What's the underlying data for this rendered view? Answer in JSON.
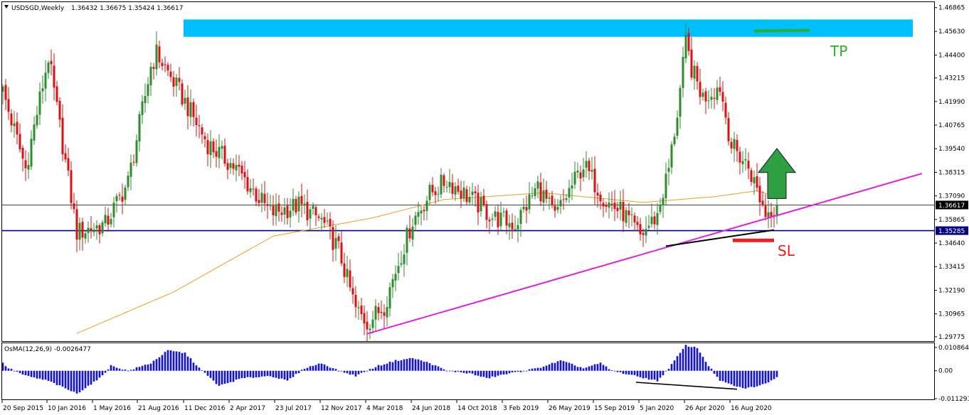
{
  "header": {
    "symbol_timeframe": "USDSGD,Weekly",
    "ohlc": "1.36432 1.36675 1.35424 1.36617"
  },
  "indicator": {
    "title": "OsMA(12,26,9) -0.0026477",
    "ticks": [
      "0.0108644",
      "0.00",
      "-0.0112917"
    ]
  },
  "annotations": {
    "tp": "TP",
    "sl": "SL"
  },
  "colors": {
    "bull": "#2e8b2e",
    "bear": "#dd1111",
    "ma": "#e8a020",
    "trendline": "#e020e0",
    "resistance_zone": "#00bfff",
    "osma": "#1010ee",
    "tp": "#2ab02a",
    "sl": "#ee1c1c",
    "arrow": "#2ea043",
    "support_line": "#000080"
  },
  "chart_data": [
    {
      "type": "candlestick",
      "title": "USDSGD,Weekly",
      "y_ticks": [
        "1.46865",
        "1.45630",
        "1.44400",
        "1.43215",
        "1.41990",
        "1.40765",
        "1.39540",
        "1.38315",
        "1.37090",
        "1.35865",
        "1.34640",
        "1.33415",
        "1.32190",
        "1.30965",
        "1.29775"
      ],
      "x_ticks": [
        "20 Sep 2015",
        "10 Jan 2016",
        "1 May 2016",
        "21 Aug 2016",
        "11 Dec 2016",
        "2 Apr 2017",
        "23 Jul 2017",
        "12 Nov 2017",
        "4 Mar 2018",
        "24 Jun 2018",
        "14 Oct 2018",
        "3 Feb 2019",
        "26 May 2019",
        "15 Sep 2019",
        "5 Jan 2020",
        "26 Apr 2020",
        "16 Aug 2020"
      ],
      "ylim": [
        1.2955,
        1.4715
      ],
      "price_labels": [
        {
          "text": "1.36617",
          "value": 1.36617
        },
        {
          "text": "1.35285",
          "value": 1.35285
        }
      ],
      "series_keypoints": [
        [
          0,
          1.425
        ],
        [
          8,
          1.385
        ],
        [
          16,
          1.443
        ],
        [
          26,
          1.352
        ],
        [
          36,
          1.356
        ],
        [
          44,
          1.378
        ],
        [
          52,
          1.438
        ],
        [
          54,
          1.445
        ],
        [
          62,
          1.425
        ],
        [
          72,
          1.398
        ],
        [
          82,
          1.385
        ],
        [
          94,
          1.362
        ],
        [
          104,
          1.366
        ],
        [
          112,
          1.358
        ],
        [
          118,
          1.343
        ],
        [
          124,
          1.312
        ],
        [
          128,
          1.305
        ],
        [
          134,
          1.314
        ],
        [
          138,
          1.332
        ],
        [
          144,
          1.358
        ],
        [
          150,
          1.372
        ],
        [
          156,
          1.379
        ],
        [
          164,
          1.37
        ],
        [
          172,
          1.36
        ],
        [
          180,
          1.356
        ],
        [
          188,
          1.376
        ],
        [
          194,
          1.36
        ],
        [
          204,
          1.387
        ],
        [
          212,
          1.368
        ],
        [
          218,
          1.362
        ],
        [
          224,
          1.35
        ],
        [
          230,
          1.361
        ],
        [
          234,
          1.385
        ],
        [
          237,
          1.414
        ],
        [
          240,
          1.45
        ],
        [
          242,
          1.437
        ],
        [
          246,
          1.422
        ],
        [
          252,
          1.428
        ],
        [
          256,
          1.397
        ],
        [
          262,
          1.386
        ],
        [
          268,
          1.362
        ],
        [
          272,
          1.36617
        ]
      ],
      "moving_average_keypoints": [
        [
          26,
          1.2995
        ],
        [
          60,
          1.321
        ],
        [
          95,
          1.35
        ],
        [
          130,
          1.3595
        ],
        [
          155,
          1.369
        ],
        [
          190,
          1.3725
        ],
        [
          225,
          1.3675
        ],
        [
          250,
          1.3705
        ],
        [
          265,
          1.3735
        ],
        [
          272,
          1.3705
        ]
      ],
      "resistance_zone": [
        1.4535,
        1.4625
      ],
      "support_level": 1.35285,
      "trendline": [
        [
          128,
          1.2993
        ],
        [
          323,
          1.3825
        ]
      ],
      "tp_level": 1.4565,
      "sl_level": 1.3478,
      "arrow": {
        "x": 272,
        "bottom": 1.3695,
        "top": 1.3955
      },
      "divergence_price": [
        [
          233,
          1.3448
        ],
        [
          271,
          1.3532
        ]
      ]
    },
    {
      "type": "bar",
      "title": "OsMA(12,26,9)",
      "ylim": [
        -0.0112917,
        0.0108644
      ],
      "last_value": -0.0026477,
      "keypoints": [
        [
          0,
          0.003
        ],
        [
          2,
          0.001
        ],
        [
          8,
          -0.002
        ],
        [
          16,
          -0.004
        ],
        [
          26,
          -0.009
        ],
        [
          34,
          -0.003
        ],
        [
          38,
          0.002
        ],
        [
          44,
          0.0
        ],
        [
          52,
          0.003
        ],
        [
          58,
          0.008
        ],
        [
          64,
          0.007
        ],
        [
          70,
          0.0
        ],
        [
          76,
          -0.006
        ],
        [
          84,
          -0.003
        ],
        [
          94,
          -0.002
        ],
        [
          100,
          -0.004
        ],
        [
          106,
          0.001
        ],
        [
          112,
          0.003
        ],
        [
          118,
          0.0
        ],
        [
          124,
          -0.002
        ],
        [
          132,
          0.002
        ],
        [
          138,
          0.004
        ],
        [
          144,
          0.005
        ],
        [
          150,
          0.003
        ],
        [
          156,
          0.0
        ],
        [
          164,
          -0.001
        ],
        [
          170,
          -0.003
        ],
        [
          176,
          -0.0015
        ],
        [
          188,
          0.001
        ],
        [
          196,
          0.004
        ],
        [
          204,
          0.001
        ],
        [
          210,
          0.003
        ],
        [
          214,
          0.0
        ],
        [
          222,
          -0.002
        ],
        [
          230,
          -0.004
        ],
        [
          234,
          0.001
        ],
        [
          240,
          0.01
        ],
        [
          244,
          0.009
        ],
        [
          248,
          0.002
        ],
        [
          252,
          -0.004
        ],
        [
          260,
          -0.007
        ],
        [
          266,
          -0.006
        ],
        [
          272,
          -0.0026477
        ]
      ],
      "divergence": [
        [
          230,
          -0.004
        ],
        [
          266,
          -0.007
        ]
      ]
    }
  ]
}
